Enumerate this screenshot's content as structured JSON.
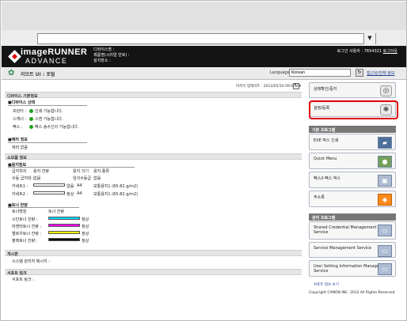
{
  "browser": {
    "address": "",
    "dropdown_icon": "chevron-down-icon"
  },
  "header": {
    "brand_title": "imageRUNNER",
    "brand_subtitle": "ADVANCE",
    "device_name_label": "디바이스명 :",
    "product_serial_label": "제품명(시리얼 번호) :",
    "location_label": "설치장소 :",
    "login_user_text": "로그인 사용자 : 7654321",
    "logout_label": "로그아웃"
  },
  "subbar": {
    "title": "리모트 UI : 포털",
    "language_label": "Language:",
    "language_value": "Korean",
    "language_submit_icon": "refresh-icon",
    "link_label": "접근성/전체 정보"
  },
  "main": {
    "last_updated": "마지막 업데이트 : 2012/05/10 09:00:28",
    "sections": {
      "basic_info": "디바이스 기본정보",
      "device_status": "■디바이스 상태",
      "error_info": "■에러 정보",
      "consumables": "소모품 정보",
      "paper_info": "■용지정보",
      "toner": "■토너 잔량",
      "notice": "게시판",
      "support": "서포트 링크"
    },
    "status": [
      {
        "label": "프린터 :",
        "value": "인쇄 가능합니다."
      },
      {
        "label": "스캐너 :",
        "value": "스캔 가능합니다."
      },
      {
        "label": "팩스 :",
        "value": "팩스 송수신이 가능합니다."
      }
    ],
    "error_text": "에러 없음",
    "paper_headers": [
      "급지위치",
      "용지 잔량",
      "용지 크기",
      "용지 종류"
    ],
    "paper_rows": [
      {
        "source": "수동 급지대 :",
        "remaining": "없음",
        "size": "임의수동급",
        "type": "없음"
      },
      {
        "source": "카세트1 :",
        "remaining": "없음",
        "size": "A4",
        "type": "보통용지1 (65-82 g/m2)"
      },
      {
        "source": "카세트2 :",
        "remaining": "정상",
        "size": "A4",
        "type": "보통용지1 (65-82 g/m2)"
      }
    ],
    "toner_headers": [
      "토너명칭",
      "토너 잔량"
    ],
    "toner_rows": [
      {
        "name": "시안토너 잔량 :",
        "status": "정상",
        "color": "#00d8ff"
      },
      {
        "name": "마젠타토너 잔량 :",
        "status": "정상",
        "color": "#ff00ff"
      },
      {
        "name": "옐로우토너 잔량 :",
        "status": "정상",
        "color": "#ffff00"
      },
      {
        "name": "블랙토너 잔량 :",
        "status": "정상",
        "color": "#000000"
      }
    ],
    "notice_text": "시스템 관리자 메시지 :",
    "support_text": "서포트 링크 :"
  },
  "side": {
    "buttons": [
      {
        "label": "상태확인/중지",
        "icon": "eye-icon"
      },
      {
        "label": "설정/등록",
        "icon": "gear-icon"
      }
    ],
    "quick_head": "기본 프로그램",
    "quick_items": [
      {
        "label": "EXE 박스 인쇄",
        "icon": "printer-icon"
      },
      {
        "label": "Quick Menu",
        "icon": "people-icon"
      },
      {
        "label": "팩스/I-팩스 박스",
        "icon": "fax-icon"
      },
      {
        "label": "주소록",
        "icon": "address-book-icon"
      }
    ],
    "management_head": "관리 프로그램",
    "management_items": [
      {
        "label": "Shared Credential Management Service",
        "icon": "service-icon"
      },
      {
        "label": "Service Management Service",
        "icon": "service-icon"
      },
      {
        "label": "User Setting Information Management Service",
        "icon": "service-icon"
      }
    ],
    "support_link": "서포트 정보 보기",
    "copyright": "Copyright CANON INC. 2012 All Rights Reserved"
  }
}
